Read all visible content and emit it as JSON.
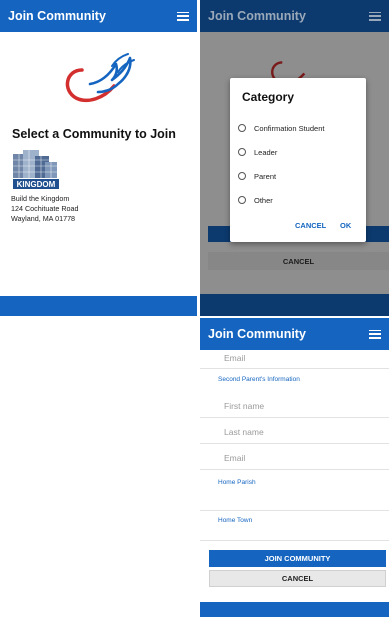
{
  "app": {
    "title": "Join Community",
    "menu_icon": "hamburger-icon"
  },
  "colors": {
    "primary": "#1565c0",
    "accent_red": "#d32f2f",
    "dim_bar": "#0d3a6e"
  },
  "screen1": {
    "heading": "Select a Community to Join",
    "logo_text": "KINGDOM",
    "address": {
      "line1": "Build the Kingdom",
      "line2": "124 Cochituate Road",
      "line3": "Wayland, MA 01778"
    }
  },
  "screen2": {
    "dialog_title": "Category",
    "options": [
      "Confirmation Student",
      "Leader",
      "Parent",
      "Other"
    ],
    "cancel": "CANCEL",
    "ok": "OK",
    "background_cancel": "CANCEL"
  },
  "screen3": {
    "email_placeholder": "Email",
    "section_second_parent": "Second Parent's Information",
    "first_name_placeholder": "First name",
    "last_name_placeholder": "Last name",
    "email2_placeholder": "Email",
    "home_parish": "Home Parish",
    "home_town": "Home Town",
    "join_button": "JOIN COMMUNITY",
    "cancel_button": "CANCEL"
  }
}
